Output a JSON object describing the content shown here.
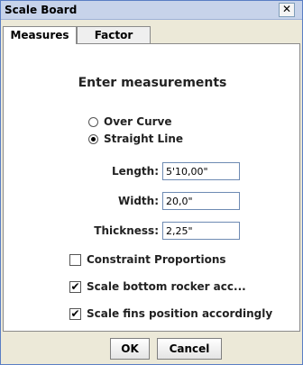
{
  "window": {
    "title": "Scale Board",
    "close_glyph": "✕"
  },
  "tabs": [
    {
      "label": "Measures",
      "active": true
    },
    {
      "label": "Factor",
      "active": false
    }
  ],
  "panel": {
    "heading": "Enter measurements",
    "options": [
      {
        "label": "Over Curve",
        "selected": false
      },
      {
        "label": "Straight Line",
        "selected": true
      }
    ],
    "fields": {
      "length": {
        "label": "Length:",
        "value": "5'10,00\""
      },
      "width": {
        "label": "Width:",
        "value": "20,0\""
      },
      "thickness": {
        "label": "Thickness:",
        "value": "2,25\""
      }
    },
    "checkboxes": [
      {
        "label": "Constraint Proportions",
        "checked": false
      },
      {
        "label": "Scale bottom rocker acc...",
        "checked": true
      },
      {
        "label": "Scale fins position accordingly",
        "checked": true
      }
    ]
  },
  "footer": {
    "ok_label": "OK",
    "cancel_label": "Cancel"
  },
  "icons": {
    "check_glyph": "✔"
  }
}
